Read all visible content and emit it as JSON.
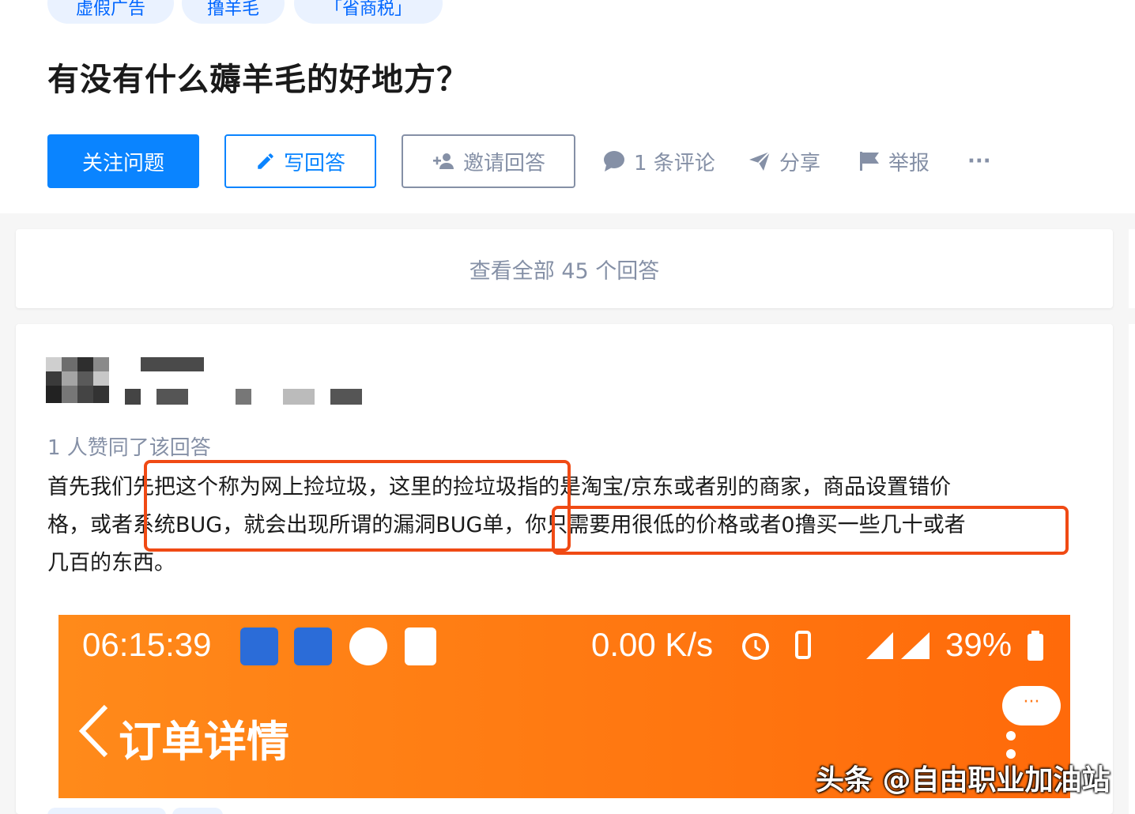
{
  "topics": [
    "虚假广告",
    "撸羊毛",
    "「省商税」"
  ],
  "question": {
    "title": "有没有什么薅羊毛的好地方？"
  },
  "actions": {
    "follow": "关注问题",
    "write": "写回答",
    "invite": "邀请回答",
    "comments": "1 条评论",
    "share": "分享",
    "report": "举报",
    "more": "···"
  },
  "view_all": "查看全部 45 个回答",
  "answer": {
    "likes": "1 人赞同了该回答",
    "lines": [
      "首先我们先把这个称为网上捡垃圾，这里的捡垃圾指的是淘宝/京东或者别的商家，商品设置错价",
      "格，或者系统BUG，就会出现所谓的漏洞BUG单，你只需要用很低的价格或者0撸买一些几十或者",
      "几百的东西。"
    ]
  },
  "screenshot": {
    "time": "06:15:39",
    "speed": "0.00 K/s",
    "battery": "39%",
    "title": "订单详情",
    "bubble": "···"
  },
  "watermark": "头条 @自由职业加油站",
  "colors": {
    "brand": "#0a84ff",
    "muted": "#8590a6",
    "highlight": "#f04a14",
    "orange": "#ff7a1a"
  }
}
